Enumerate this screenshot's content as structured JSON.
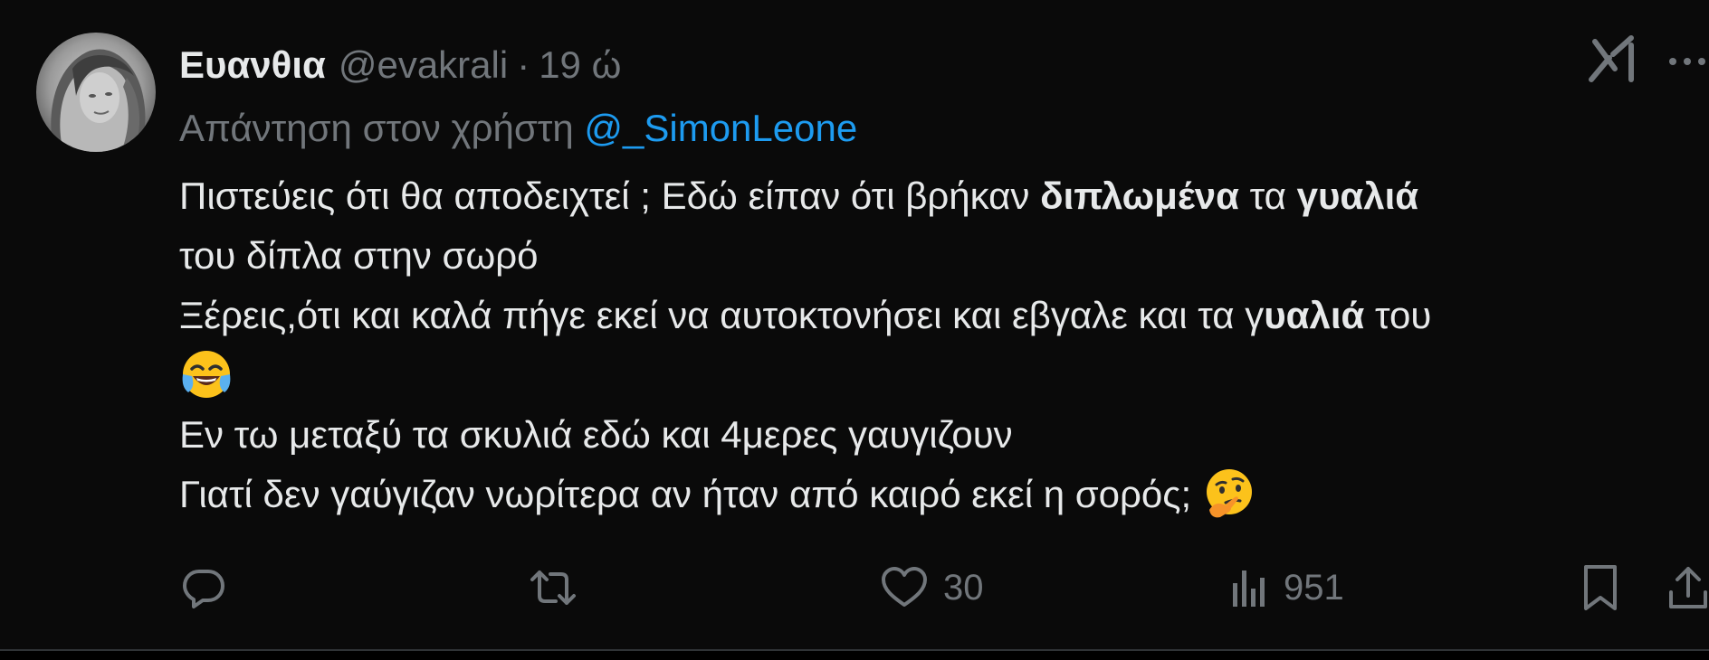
{
  "tweet": {
    "author": {
      "display_name": "Ευανθια",
      "handle": "@evakrali",
      "separator": "·",
      "time": "19 ώ"
    },
    "reply_to": {
      "prefix": "Απάντηση στον χρήστη",
      "mention": "@_SimonLeone"
    },
    "body": {
      "line1_a": "Πιστεύεις ότι θα αποδειχτεί ; Εδώ είπαν ότι βρήκαν ",
      "line1_b": "διπλωμένα",
      "line1_c": " τα ",
      "line1_d": "γυαλιά",
      "line2": "του δίπλα στην σωρό",
      "line3_a": "Ξέρεις,ότι και καλά πήγε εκεί να αυτοκτονήσει και εβγαλε και τα γ",
      "line3_b": "υαλιά",
      "line3_c": " του",
      "line4_emoji": "face-with-tears-of-joy-emoji",
      "line5": "Εν τω μεταξύ τα σκυλιά εδώ και 4μερες γαυγιζουν",
      "line6": "Γιατί δεν γαύγιζαν νωρίτερα αν ήταν από καιρό εκεί η σορός; ",
      "line6_emoji": "thinking-face-emoji"
    },
    "actions": {
      "reply": {
        "icon": "reply-icon",
        "count": ""
      },
      "repost": {
        "icon": "repost-icon",
        "count": ""
      },
      "like": {
        "icon": "heart-icon",
        "count": "30"
      },
      "views": {
        "icon": "views-icon",
        "count": "951"
      },
      "bookmark": {
        "icon": "bookmark-icon"
      },
      "share": {
        "icon": "share-icon"
      }
    },
    "top_right": {
      "grok_icon": "grok-icon",
      "more_icon": "more-icon"
    }
  },
  "colors": {
    "background": "#0a0a0a",
    "text_primary": "#e7e9ea",
    "text_secondary": "#71767b",
    "link": "#1d9bf0",
    "divider": "#2f3336"
  }
}
